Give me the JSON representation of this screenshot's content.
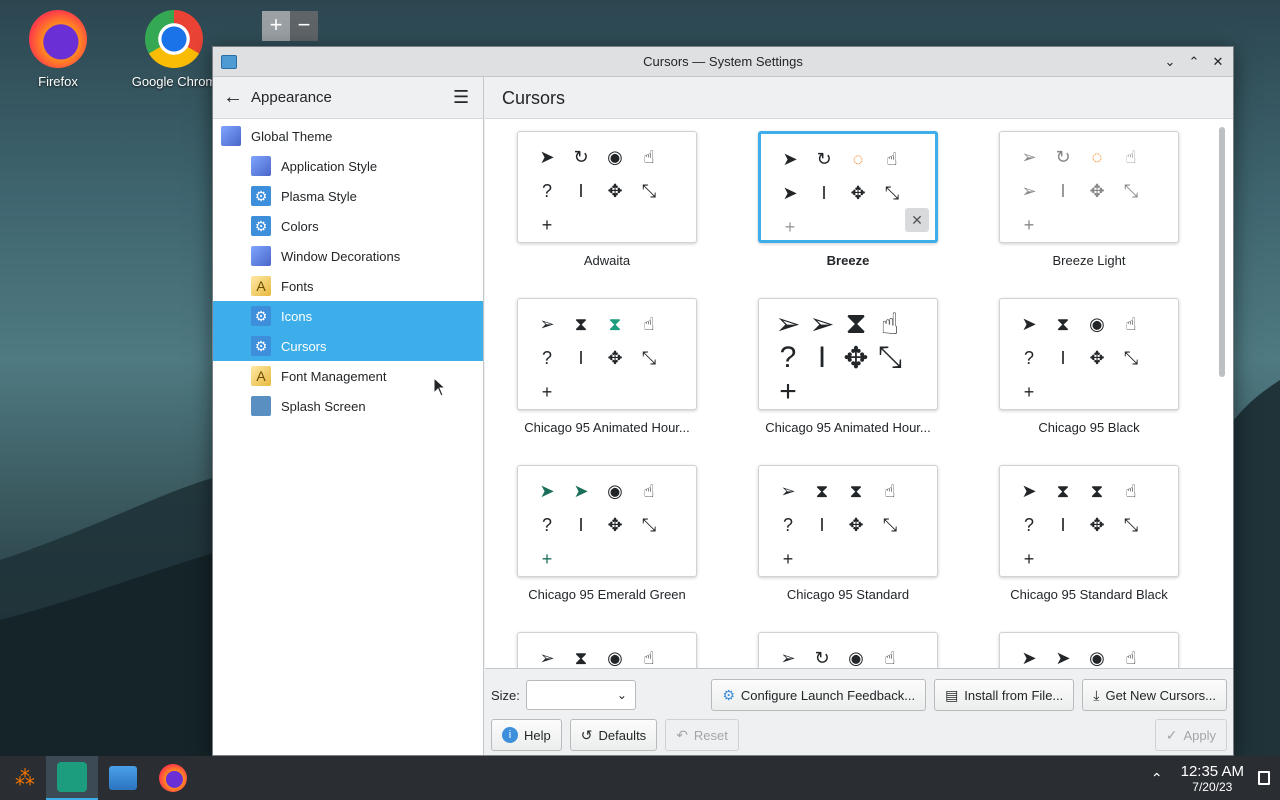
{
  "desktop": {
    "icons": [
      {
        "label": "Firefox"
      },
      {
        "label": "Google Chrom"
      }
    ],
    "zoom_plus": "+",
    "zoom_minus": "−"
  },
  "window": {
    "title": "Cursors — System Settings",
    "controls": {
      "minimize": "⌄",
      "maximize": "⌃",
      "close": "✕"
    }
  },
  "sidebar": {
    "header_title": "Appearance",
    "back_icon": "←",
    "menu_icon": "☰",
    "items": [
      {
        "label": "Global Theme",
        "icon": "monitor-icon"
      },
      {
        "label": "Application Style",
        "icon": "monitor-icon"
      },
      {
        "label": "Plasma Style",
        "icon": "gear-icon"
      },
      {
        "label": "Colors",
        "icon": "gear-icon"
      },
      {
        "label": "Window Decorations",
        "icon": "monitor-icon"
      },
      {
        "label": "Fonts",
        "icon": "font-icon"
      },
      {
        "label": "Icons",
        "icon": "gear-icon"
      },
      {
        "label": "Cursors",
        "icon": "gear-icon"
      },
      {
        "label": "Font Management",
        "icon": "font-icon"
      },
      {
        "label": "Splash Screen",
        "icon": "splash-icon"
      }
    ]
  },
  "content": {
    "header_title": "Cursors",
    "themes": [
      {
        "label": "Adwaita"
      },
      {
        "label": "Breeze"
      },
      {
        "label": "Breeze Light"
      },
      {
        "label": "Chicago 95 Animated Hour..."
      },
      {
        "label": "Chicago 95 Animated Hour..."
      },
      {
        "label": "Chicago 95 Black"
      },
      {
        "label": "Chicago 95 Emerald Green"
      },
      {
        "label": "Chicago 95 Standard"
      },
      {
        "label": "Chicago 95 Standard Black"
      }
    ],
    "remove_icon": "✕"
  },
  "bottom": {
    "size_label": "Size:",
    "size_value": "",
    "configure_label": "Configure Launch Feedback...",
    "install_label": "Install from File...",
    "get_new_label": "Get New Cursors...",
    "help_label": "Help",
    "defaults_label": "Defaults",
    "reset_label": "Reset",
    "apply_label": "Apply"
  },
  "taskbar": {
    "time": "12:35 AM",
    "date": "7/20/23"
  },
  "colors": {
    "accent": "#3daee9",
    "taskbar": "#2a2e32"
  }
}
